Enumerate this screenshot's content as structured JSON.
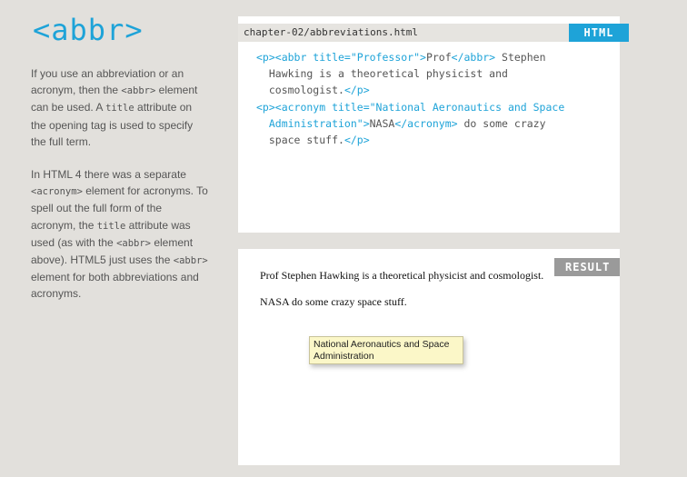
{
  "title": "<abbr>",
  "sidebar": {
    "p1": [
      {
        "t": "text",
        "v": "If you use an abbreviation or an acronym, then the "
      },
      {
        "t": "code",
        "v": "<abbr>"
      },
      {
        "t": "text",
        "v": " element can be used. A "
      },
      {
        "t": "code",
        "v": "title"
      },
      {
        "t": "text",
        "v": " attribute on the opening tag is used to specify the full term."
      }
    ],
    "p2": [
      {
        "t": "text",
        "v": "In HTML 4 there was a separate "
      },
      {
        "t": "code",
        "v": "<acronym>"
      },
      {
        "t": "text",
        "v": " element  for acronyms. To spell out the full form of the acronym, the "
      },
      {
        "t": "code",
        "v": "title"
      },
      {
        "t": "text",
        "v": " attribute was used (as with the "
      },
      {
        "t": "code",
        "v": "<abbr>"
      },
      {
        "t": "text",
        "v": " element above). HTML5 just uses the "
      },
      {
        "t": "code",
        "v": "<abbr>"
      },
      {
        "t": "text",
        "v": " element for both abbreviations and acronyms."
      }
    ]
  },
  "code_panel": {
    "filename": "chapter-02/abbreviations.html",
    "badge": "HTML",
    "lines": [
      [
        {
          "c": "blue",
          "v": "<p><abbr title=\"Professor\">"
        },
        {
          "c": "",
          "v": "Prof"
        },
        {
          "c": "blue",
          "v": "</abbr>"
        },
        {
          "c": "",
          "v": " Stephen"
        }
      ],
      [
        {
          "c": "",
          "v": "  Hawking is a theoretical physicist and"
        }
      ],
      [
        {
          "c": "",
          "v": "  cosmologist."
        },
        {
          "c": "blue",
          "v": "</p>"
        }
      ],
      [
        {
          "c": "blue",
          "v": "<p><acronym title=\"National Aeronautics and Space"
        }
      ],
      [
        {
          "c": "blue",
          "v": "  Administration\">"
        },
        {
          "c": "",
          "v": "NASA"
        },
        {
          "c": "blue",
          "v": "</acronym>"
        },
        {
          "c": "",
          "v": " do some crazy"
        }
      ],
      [
        {
          "c": "",
          "v": "  space stuff."
        },
        {
          "c": "blue",
          "v": "</p>"
        }
      ]
    ]
  },
  "result_panel": {
    "badge": "RESULT",
    "line1": "Prof Stephen Hawking is a theoretical physicist and cosmologist.",
    "line2": "NASA do some crazy space stuff.",
    "tooltip": "National Aeronautics and Space Administration"
  }
}
